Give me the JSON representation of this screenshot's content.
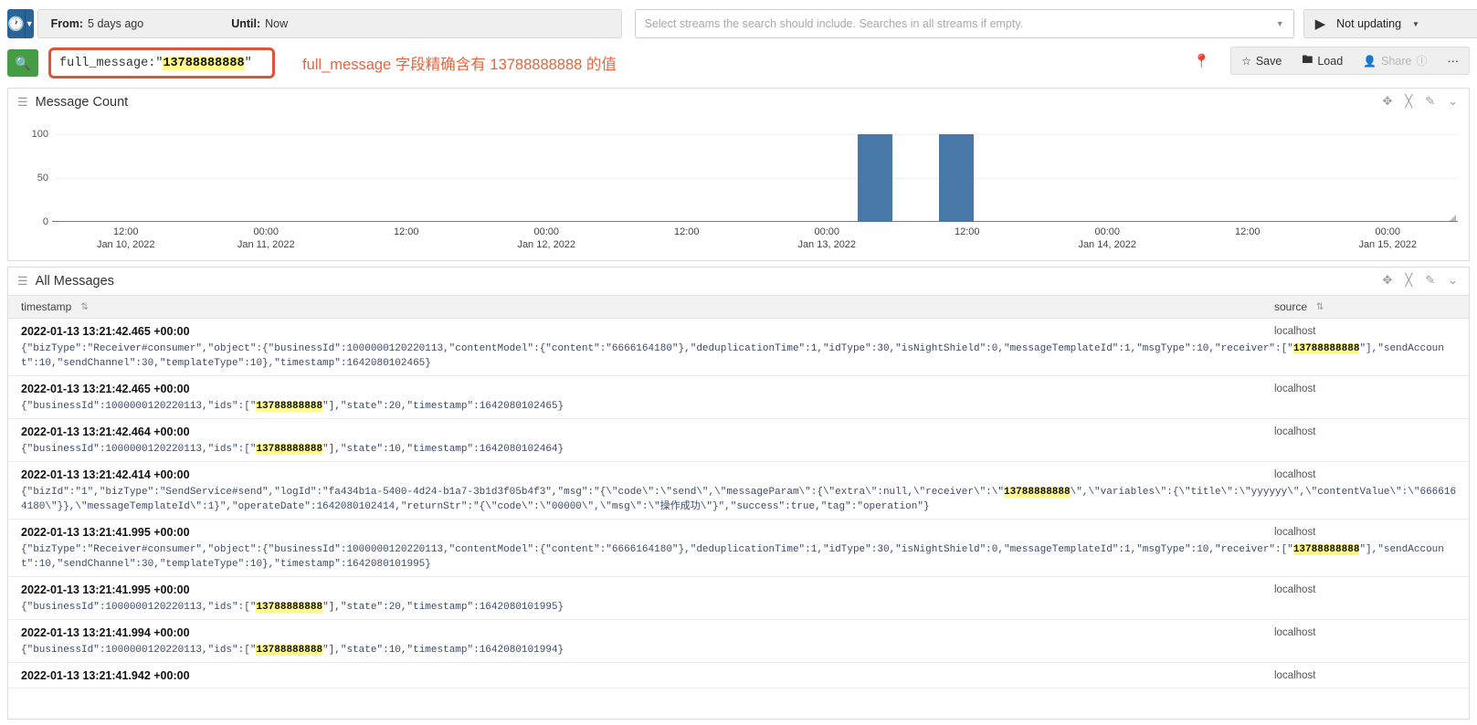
{
  "topbar": {
    "time_icon": "clock-icon",
    "caret_icon": "caret-down-icon",
    "from_label": "From:",
    "from_value": "5 days ago",
    "until_label": "Until:",
    "until_value": "Now",
    "streams_placeholder": "Select streams the search should include. Searches in all streams if empty.",
    "streams_value": "",
    "update_icon": "play-icon",
    "update_label": "Not updating",
    "update_caret": "caret-down-icon"
  },
  "query": {
    "search_icon": "search-icon",
    "field": "full_message:",
    "value_quote_open": "\"",
    "value": "13788888888",
    "value_quote_close": "\"",
    "annotation": "full_message 字段精确含有 13788888888 的值",
    "highlight_color": "#fffa8a",
    "outline_color": "#d8563c",
    "annotation_color": "#e8643c",
    "pin_icon": "pin-icon",
    "save_label": "Save",
    "save_icon": "star-icon",
    "load_label": "Load",
    "load_icon": "folder-icon",
    "share_label": "Share",
    "share_icon": "user-share-icon",
    "help_icon": "question-circle-icon",
    "more_icon": "ellipsis-icon"
  },
  "chart_widget": {
    "grip_icon": "drag-handle-icon",
    "title": "Message Count",
    "tools": [
      "move-icon",
      "fullscreen-icon",
      "edit-icon",
      "chevron-down-icon"
    ]
  },
  "chart_data": {
    "type": "bar",
    "title": "Message Count",
    "xlabel": "",
    "ylabel": "",
    "ylim": [
      0,
      110
    ],
    "yticks": [
      0,
      50,
      100
    ],
    "grid": true,
    "legend": false,
    "xtick_labels": [
      {
        "time": "12:00",
        "date": "Jan 10, 2022"
      },
      {
        "time": "00:00",
        "date": "Jan 11, 2022"
      },
      {
        "time": "12:00",
        "date": ""
      },
      {
        "time": "00:00",
        "date": "Jan 12, 2022"
      },
      {
        "time": "12:00",
        "date": ""
      },
      {
        "time": "00:00",
        "date": "Jan 13, 2022"
      },
      {
        "time": "12:00",
        "date": ""
      },
      {
        "time": "00:00",
        "date": "Jan 14, 2022"
      },
      {
        "time": "12:00",
        "date": ""
      },
      {
        "time": "00:00",
        "date": "Jan 15, 2022"
      }
    ],
    "bar_color": "#4878a8",
    "categories": [
      "2022-01-13 06:00",
      "2022-01-13 10:00"
    ],
    "values": [
      100,
      100
    ]
  },
  "messages_widget": {
    "grip_icon": "drag-handle-icon",
    "title": "All Messages",
    "tools": [
      "move-icon",
      "fullscreen-icon",
      "edit-icon",
      "chevron-down-icon"
    ],
    "columns": {
      "timestamp": "timestamp",
      "timestamp_sort_icon": "sort-icon",
      "source": "source",
      "source_sort_icon": "sort-icon"
    },
    "rows": [
      {
        "timestamp": "2022-01-13 13:21:42.465 +00:00",
        "source": "localhost",
        "body_pre": "{\"bizType\":\"Receiver#consumer\",\"object\":{\"businessId\":1000000120220113,\"contentModel\":{\"content\":\"6666164180\"},\"deduplicationTime\":1,\"idType\":30,\"isNightShield\":0,\"messageTemplateId\":1,\"msgType\":10,\"receiver\":[\"",
        "body_hl": "13788888888",
        "body_post": "\"],\"sendAccount\":10,\"sendChannel\":30,\"templateType\":10},\"timestamp\":1642080102465}"
      },
      {
        "timestamp": "2022-01-13 13:21:42.465 +00:00",
        "source": "localhost",
        "body_pre": "{\"businessId\":1000000120220113,\"ids\":[\"",
        "body_hl": "13788888888",
        "body_post": "\"],\"state\":20,\"timestamp\":1642080102465}"
      },
      {
        "timestamp": "2022-01-13 13:21:42.464 +00:00",
        "source": "localhost",
        "body_pre": "{\"businessId\":1000000120220113,\"ids\":[\"",
        "body_hl": "13788888888",
        "body_post": "\"],\"state\":10,\"timestamp\":1642080102464}"
      },
      {
        "timestamp": "2022-01-13 13:21:42.414 +00:00",
        "source": "localhost",
        "body_pre": "{\"bizId\":\"1\",\"bizType\":\"SendService#send\",\"logId\":\"fa434b1a-5400-4d24-b1a7-3b1d3f05b4f3\",\"msg\":\"{\\\"code\\\":\\\"send\\\",\\\"messageParam\\\":{\\\"extra\\\":null,\\\"receiver\\\":\\\"",
        "body_hl": "13788888888",
        "body_post": "\\\",\\\"variables\\\":{\\\"title\\\":\\\"yyyyyy\\\",\\\"contentValue\\\":\\\"6666164180\\\"}},\\\"messageTemplateId\\\":1}\",\"operateDate\":1642080102414,\"returnStr\":\"{\\\"code\\\":\\\"00000\\\",\\\"msg\\\":\\\"操作成功\\\"}\",\"success\":true,\"tag\":\"operation\"}"
      },
      {
        "timestamp": "2022-01-13 13:21:41.995 +00:00",
        "source": "localhost",
        "body_pre": "{\"bizType\":\"Receiver#consumer\",\"object\":{\"businessId\":1000000120220113,\"contentModel\":{\"content\":\"6666164180\"},\"deduplicationTime\":1,\"idType\":30,\"isNightShield\":0,\"messageTemplateId\":1,\"msgType\":10,\"receiver\":[\"",
        "body_hl": "13788888888",
        "body_post": "\"],\"sendAccount\":10,\"sendChannel\":30,\"templateType\":10},\"timestamp\":1642080101995}"
      },
      {
        "timestamp": "2022-01-13 13:21:41.995 +00:00",
        "source": "localhost",
        "body_pre": "{\"businessId\":1000000120220113,\"ids\":[\"",
        "body_hl": "13788888888",
        "body_post": "\"],\"state\":20,\"timestamp\":1642080101995}"
      },
      {
        "timestamp": "2022-01-13 13:21:41.994 +00:00",
        "source": "localhost",
        "body_pre": "{\"businessId\":1000000120220113,\"ids\":[\"",
        "body_hl": "13788888888",
        "body_post": "\"],\"state\":10,\"timestamp\":1642080101994}"
      },
      {
        "timestamp": "2022-01-13 13:21:41.942 +00:00",
        "source": "localhost",
        "body_pre": "",
        "body_hl": "",
        "body_post": ""
      }
    ]
  }
}
